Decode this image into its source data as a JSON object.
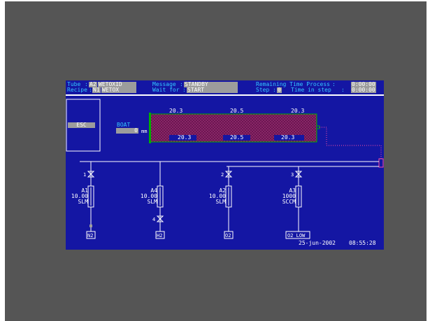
{
  "header": {
    "tube_label": "Tube",
    "tube_value": "A2",
    "tube_recipe_name": "WETOXID",
    "recipe_label": "Recipe",
    "recipe_value": "N1",
    "recipe_name": "WETOX",
    "message_label": "Message",
    "message_value": "STANDBY",
    "wait_label": "Wait for",
    "wait_value": "START",
    "remaining_label": "Remaining Time Process",
    "remaining_value": "0:00:00",
    "step_label": "Step",
    "step_value": "0",
    "time_in_step_label": "Time in step",
    "time_in_step_value": "0:00:00"
  },
  "esc_button": "ESC",
  "boat": {
    "label": "BOAT",
    "value": "0",
    "unit": "mm"
  },
  "furnace": {
    "top_temps": [
      "20.3",
      "20.5",
      "20.3"
    ],
    "bottom_temps": [
      "20.3",
      "20.5",
      "20.3"
    ],
    "colors": {
      "tube": "#7a1a5a",
      "end": "#00b000"
    }
  },
  "gas_lines": [
    {
      "valve": "1",
      "mfc": "A1",
      "flow": "10.00",
      "unit": "SLM",
      "source": "N2"
    },
    {
      "valve": "4",
      "mfc": "A4",
      "flow": "10.00",
      "unit": "SLM",
      "source": "H2"
    },
    {
      "valve": "2",
      "mfc": "A2",
      "flow": "10.00",
      "unit": "SLM",
      "source": "O2"
    },
    {
      "valve": "3",
      "mfc": "A3",
      "flow": "1000",
      "unit": "SCCM",
      "source": "O2 LOW"
    }
  ],
  "footer": {
    "date": "25-jun-2002",
    "time": "08:55:28"
  },
  "colors": {
    "screen_bg": "#1416a3",
    "cyan": "#35c7ff",
    "field_grey": "#9c9c9c",
    "frame": "#555555"
  }
}
